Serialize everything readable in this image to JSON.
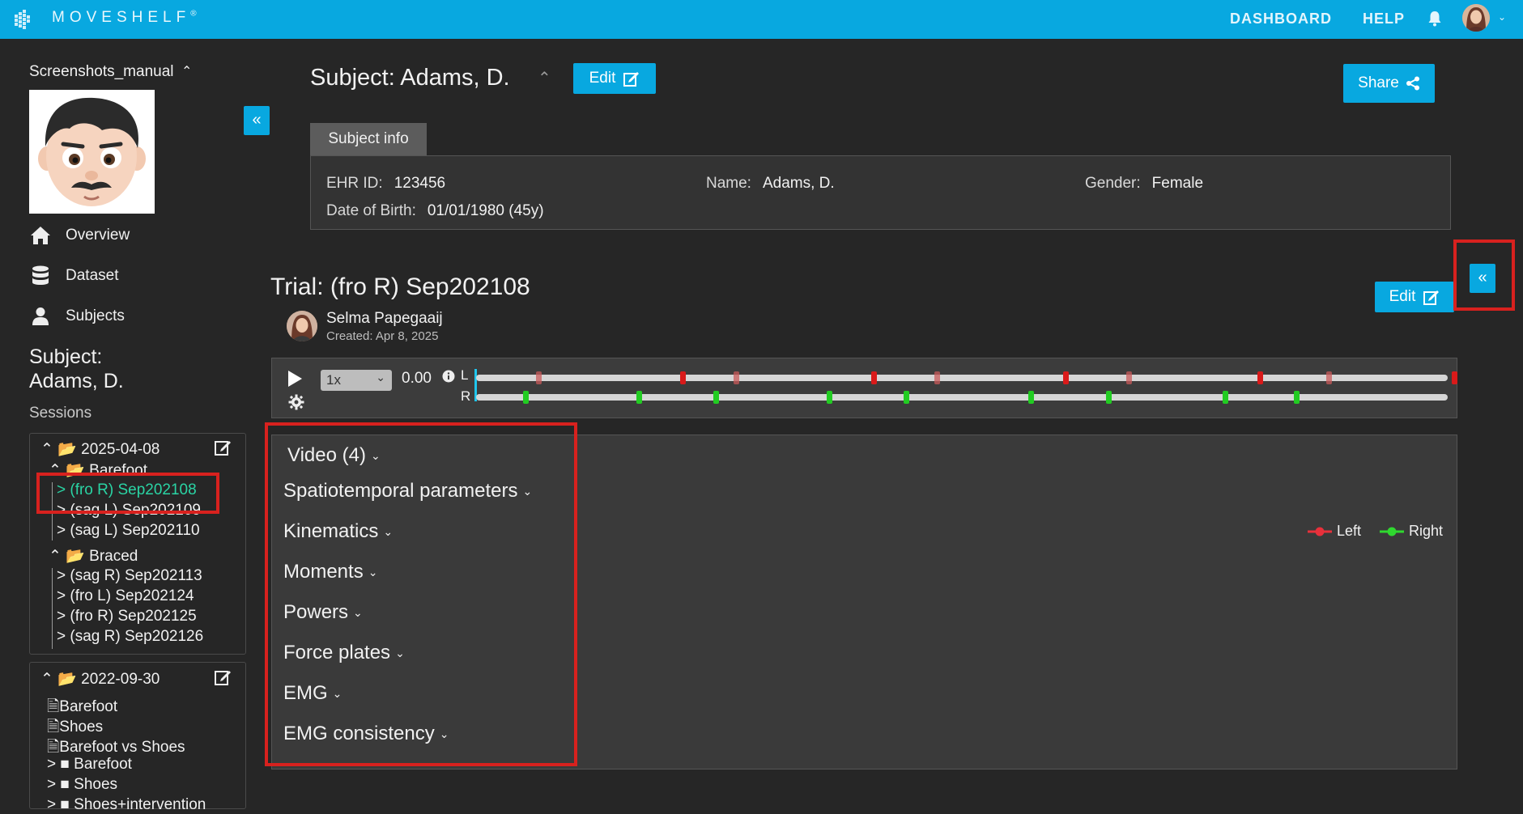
{
  "header": {
    "brand": "MOVESHELF",
    "brand_mark": "®",
    "nav": {
      "dashboard": "DASHBOARD",
      "help": "HELP"
    },
    "icons": [
      "bell-icon",
      "user-avatar",
      "chevron-down-icon"
    ]
  },
  "sidebar": {
    "project": "Screenshots_manual",
    "nav": [
      {
        "label": "Overview",
        "icon": "home-icon"
      },
      {
        "label": "Dataset",
        "icon": "database-icon"
      },
      {
        "label": "Subjects",
        "icon": "user-icon"
      }
    ],
    "subject_heading": "Subject: Adams, D.",
    "subject_heading_line1": "Subject:",
    "subject_heading_line2": "Adams, D.",
    "sessions_label": "Sessions",
    "session1": {
      "date": "2025-04-08",
      "group1": {
        "name": "Barefoot",
        "trials": [
          "(fro R) Sep202108",
          "(sag L) Sep202109",
          "(sag L) Sep202110"
        ]
      },
      "group2": {
        "name": "Braced",
        "trials": [
          "(sag R) Sep202113",
          "(fro L) Sep202124",
          "(fro R) Sep202125",
          "(sag R) Sep202126"
        ]
      }
    },
    "session2": {
      "date": "2022-09-30",
      "docs": [
        "Barefoot",
        "Shoes",
        "Barefoot vs Shoes"
      ],
      "folders": [
        "Barefoot",
        "Shoes",
        "Shoes+intervention"
      ]
    }
  },
  "subject": {
    "title": "Subject: Adams, D.",
    "edit_label": "Edit",
    "share_label": "Share",
    "tab": "Subject info",
    "ehr_label": "EHR ID:",
    "ehr_value": "123456",
    "name_label": "Name:",
    "name_value": "Adams, D.",
    "gender_label": "Gender:",
    "gender_value": "Female",
    "dob_label": "Date of Birth:",
    "dob_value": "01/01/1980 (45y)"
  },
  "trial": {
    "title": "Trial: (fro R) Sep202108",
    "edit_label": "Edit",
    "author": "Selma Papegaaij",
    "created": "Created: Apr 8, 2025"
  },
  "player": {
    "speed": "1x",
    "time": "0.00",
    "left_label": "L",
    "right_label": "R"
  },
  "sections": [
    "Video (4)",
    "Spatiotemporal parameters",
    "Kinematics",
    "Moments",
    "Powers",
    "Force plates",
    "EMG",
    "EMG consistency"
  ],
  "legend": {
    "left": "Left",
    "right": "Right"
  },
  "colors": {
    "accent": "#08a8e0",
    "background": "#262626",
    "active_trial": "#2ad4a4",
    "left_event": "#d91a1a",
    "right_event": "#22cc22",
    "highlight_box": "#d8211e"
  }
}
